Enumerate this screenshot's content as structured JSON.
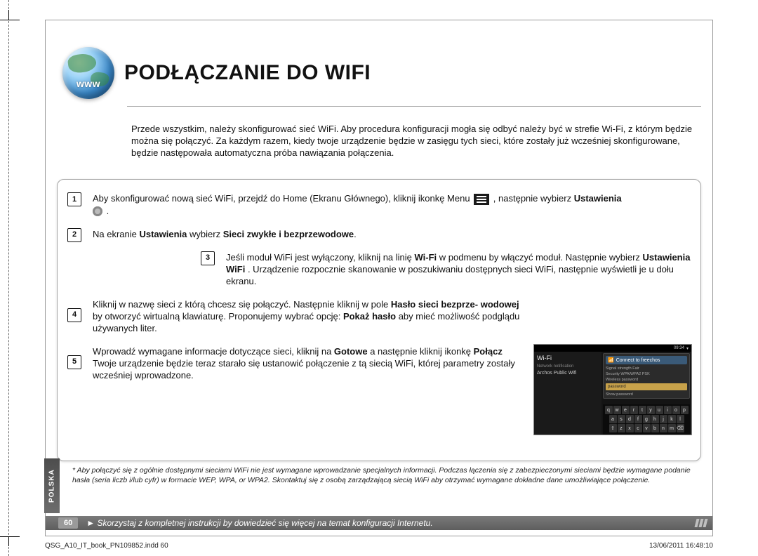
{
  "lang_tab": "POLSKA",
  "globe_label": "www",
  "title": "PODŁĄCZANIE DO WIFI",
  "intro": "Przede wszystkim, należy skonfigurować sieć WiFi. Aby procedura konfiguracji mogła się odbyć należy być w strefie Wi-Fi, z którym będzie można się połączyć. Za każdym razem, kiedy twoje urządzenie będzie w zasięgu tych sieci, które zostały już wcześniej skonfigurowane, będzie następowała automatyczna próba nawiązania połączenia.",
  "steps": {
    "s1": {
      "num": "1",
      "text_a": "Aby skonfigurować nową sieć WiFi, przejdź do Home (Ekranu Głównego), kliknij ikonkę Menu ",
      "text_b": " , następnie wybierz ",
      "text_bold_end": "Ustawienia",
      "text_c": " ."
    },
    "s2": {
      "num": "2",
      "text_a": "Na ekranie ",
      "bold1": "Ustawienia",
      "text_b": " wybierz ",
      "bold2": "Sieci zwykłe i bezprzewodowe",
      "text_c": "."
    },
    "s3": {
      "num": "3",
      "text_a": "Jeśli moduł WiFi jest wyłączony, kliknij na linię ",
      "bold1": "Wi-Fi",
      "text_b": " w podmenu by włączyć moduł. Następnie wybierz ",
      "bold2": "Ustawienia WiFi",
      "text_c": ". Urządzenie rozpocznie skanowanie w poszukiwaniu dostępnych sieci WiFi, następnie wyświetli je u dołu ekranu."
    },
    "s4": {
      "num": "4",
      "text_a": "Kliknij w nazwę sieci z którą chcesz się połączyć. Następnie kliknij w pole ",
      "bold1": "Hasło sieci bezprze- wodowej",
      "text_b": " by otworzyć wirtualną klawiaturę. Proponujemy wybrać opcję: ",
      "bold2": "Pokaż hasło",
      "text_c": " aby mieć możliwość podglądu używanych liter."
    },
    "s5": {
      "num": "5",
      "text_a": "Wprowadź wymagane informacje dotyczące sieci, kliknij na ",
      "bold1": "Gotowe",
      "text_b": " a następnie kliknij ikonkę ",
      "bold2": "Połącz",
      "text_c": " Twoje urządzenie będzie teraz starało się ustanowić połączenie z tą siecią WiFi, której parametry zostały wcześniej wprowadzone."
    }
  },
  "shot": {
    "time": "09:34",
    "wifi_title": "Wi-Fi",
    "nn": "Network notification",
    "ap": "Archos Public Wifi",
    "dlg_title": "Connect to freechos",
    "row_sig": "Signal strength  Fair",
    "row_sec": "Security  WPA/WPA2 PSK",
    "row_wp": "Wireless password",
    "pw_value": "password",
    "row_show": "Show password",
    "keys_r1": [
      "q",
      "w",
      "e",
      "r",
      "t",
      "y",
      "u",
      "i",
      "o",
      "p"
    ],
    "keys_r2": [
      "a",
      "s",
      "d",
      "f",
      "g",
      "h",
      "j",
      "k",
      "l"
    ],
    "keys_r3": [
      "⇧",
      "z",
      "x",
      "c",
      "v",
      "b",
      "n",
      "m",
      "⌫"
    ]
  },
  "footnote": "* Aby połączyć się z ogólnie dostępnymi sieciami WiFi nie jest wymagane wprowadzanie specjalnych informacji. Podczas łączenia się z zabezpieczonymi sieciami będzie wymagane podanie hasła (seria liczb i/lub cyfr) w formacie WEP, WPA, or WPA2. Skontaktuj się z osobą zarządzającą siecią WiFi aby otrzymać wymagane dokładne dane umożliwiające połączenie.",
  "bottom": {
    "page_num": "60",
    "text": "► Skorzystaj z kompletnej instrukcji by dowiedzieć się więcej na temat konfiguracji Internetu."
  },
  "indd_left": "QSG_A10_IT_book_PN109852.indd   60",
  "indd_right": "13/06/2011   16:48:10"
}
